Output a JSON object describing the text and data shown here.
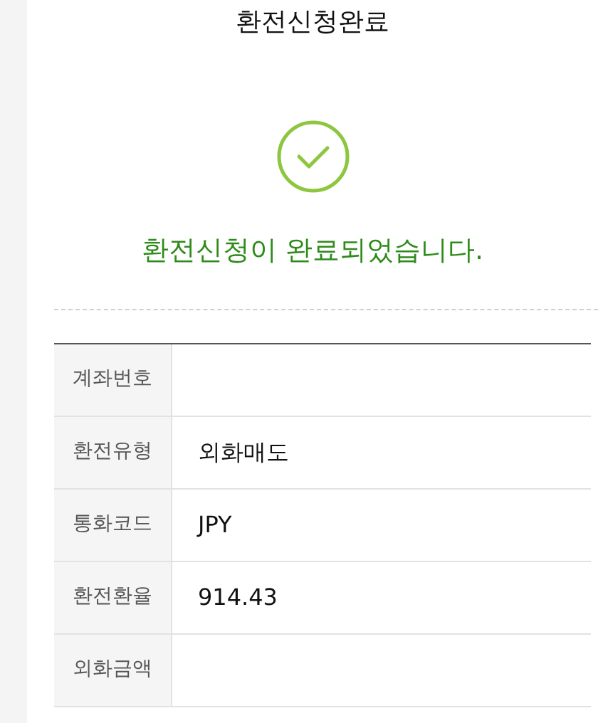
{
  "header": {
    "title": "환전신청완료"
  },
  "result": {
    "message": "환전신청이 완료되었습니다."
  },
  "details": [
    {
      "label": "계좌번호"
    },
    {
      "label": "환전유형",
      "value": "외화매도"
    },
    {
      "label": "통화코드",
      "value": "JPY"
    },
    {
      "label": "환전환율",
      "value": "914.43"
    },
    {
      "label": "외화금액"
    }
  ]
}
